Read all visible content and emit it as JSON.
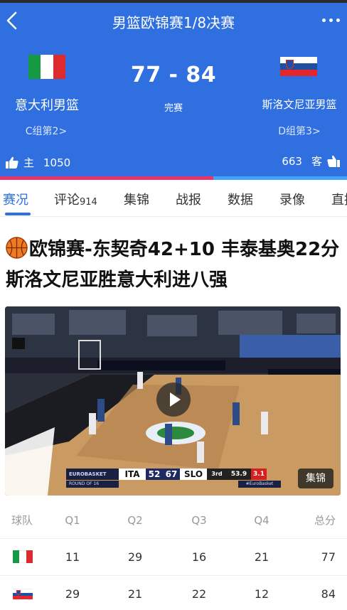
{
  "header": {
    "title": "男篮欧锦赛1/8决赛",
    "home_team": "意大利男篮",
    "away_team": "斯洛文尼亚男篮",
    "home_group": "C组第2>",
    "away_group": "D组第3>",
    "score": "77 - 84",
    "status": "完赛",
    "home_label": "主",
    "away_label": "客",
    "home_likes": "1050",
    "away_likes": "663",
    "home_vote_share": 0.614,
    "colors": {
      "background": "#2f6fe0",
      "home_bar": "#e8356e",
      "away_bar": "#3da4ff"
    }
  },
  "tabs": [
    {
      "label": "赛况",
      "count": ""
    },
    {
      "label": "评论",
      "count": "914"
    },
    {
      "label": "集锦",
      "count": ""
    },
    {
      "label": "战报",
      "count": ""
    },
    {
      "label": "数据",
      "count": ""
    },
    {
      "label": "录像",
      "count": ""
    },
    {
      "label": "直播",
      "count": ""
    }
  ],
  "article": {
    "icon": "basketball-icon",
    "headline": "欧锦赛-东契奇42+10 丰泰基奥22分 斯洛文尼亚胜意大利进八强"
  },
  "video": {
    "highlights_label": "集锦",
    "play_icon": "play-icon",
    "scorebug": {
      "league": "EUROBASKET",
      "round": "ROUND OF 16",
      "team1": "ITA",
      "score1": "52",
      "score2": "67",
      "team2": "SLO",
      "quarter": "3rd",
      "clock": "53.9",
      "shot_clock": "3.1",
      "hashtag": "#EuroBasket"
    }
  },
  "score_table": {
    "headers": [
      "球队",
      "Q1",
      "Q2",
      "Q3",
      "Q4",
      "总分"
    ],
    "rows": [
      {
        "flag": "italy-flag-icon",
        "q1": "11",
        "q2": "29",
        "q3": "16",
        "q4": "21",
        "total": "77"
      },
      {
        "flag": "slovenia-flag-icon",
        "q1": "29",
        "q2": "21",
        "q3": "22",
        "q4": "12",
        "total": "84"
      }
    ]
  }
}
